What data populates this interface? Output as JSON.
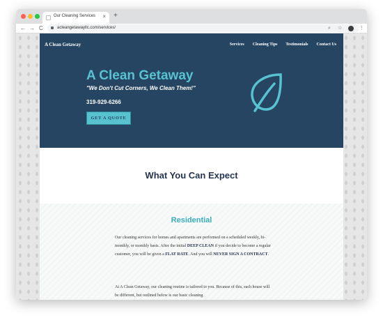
{
  "browser": {
    "tab_title": "Our Cleaning Services",
    "tab_close": "×",
    "new_tab": "+",
    "url": "acleangetawayllc.com/services/",
    "back": "←",
    "forward": "→",
    "reload": "C",
    "search_glyph": "⌕",
    "bookmark_glyph": "☆",
    "menu_glyph": "⋮"
  },
  "site": {
    "brand": "A Clean Getaway",
    "nav": [
      "Services",
      "Cleaning Tips",
      "Testimonials",
      "Contact Us"
    ],
    "hero": {
      "title": "A Clean Getaway",
      "tagline": "\"We Don't Cut Corners, We Clean Them!\"",
      "phone": "319-929-6266",
      "cta": "GET A QUOTE"
    },
    "expect_title": "What You Can Expect",
    "residential": {
      "title": "Residential",
      "p1_a": "Our cleaning services for homes and apartments are performed on a scheduled weekly, bi-monthly, or monthly basis. After the initial ",
      "p1_b": "DEEP CLEAN",
      "p1_c": " if you decide to become a regular customer, you will be given a ",
      "p1_d": "FLAT RATE",
      "p1_e": ". And you will ",
      "p1_f": "NEVER SIGN A CONTRACT",
      "p1_g": ".",
      "p2": "At A Clean Getaway, our cleaning routine is tailored to you. Because of this, each house will be different, but outlined below is our basic cleaning"
    }
  },
  "colors": {
    "hero_bg": "#254563",
    "accent": "#58c2cf",
    "heading": "#25344f"
  }
}
